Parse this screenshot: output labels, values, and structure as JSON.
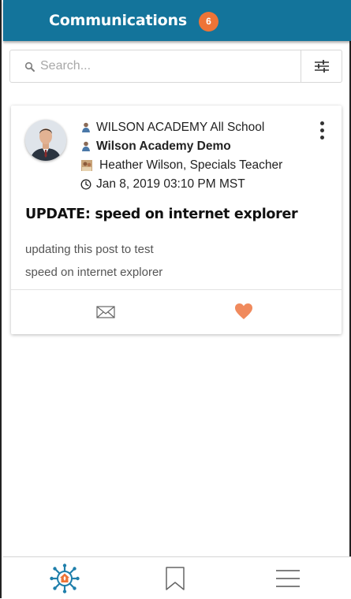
{
  "header": {
    "title": "Communications",
    "badge_count": "6",
    "bg_color": "#13749b",
    "badge_color": "#ee7437"
  },
  "search": {
    "placeholder": "Search...",
    "value": "",
    "search_icon": "search-icon",
    "filter_icon": "sliders-icon"
  },
  "post": {
    "avatar": "avatar-photo",
    "audience": "WILSON ACADEMY All School",
    "organization": "Wilson Academy Demo",
    "author": "Heather Wilson, Specials Teacher",
    "timestamp": "Jan 8, 2019 03:10 PM MST",
    "title": "UPDATE: speed on internet explorer",
    "body_line1": "updating this post to test",
    "body_line2": "speed on internet explorer",
    "mail_icon": "mail-icon",
    "heart_icon": "heart-icon",
    "heart_color": "#f08a5d"
  },
  "nav": {
    "items": [
      {
        "name": "home",
        "icon": "app-logo-icon"
      },
      {
        "name": "bookmarks",
        "icon": "bookmark-icon"
      },
      {
        "name": "menu",
        "icon": "hamburger-icon"
      }
    ]
  }
}
